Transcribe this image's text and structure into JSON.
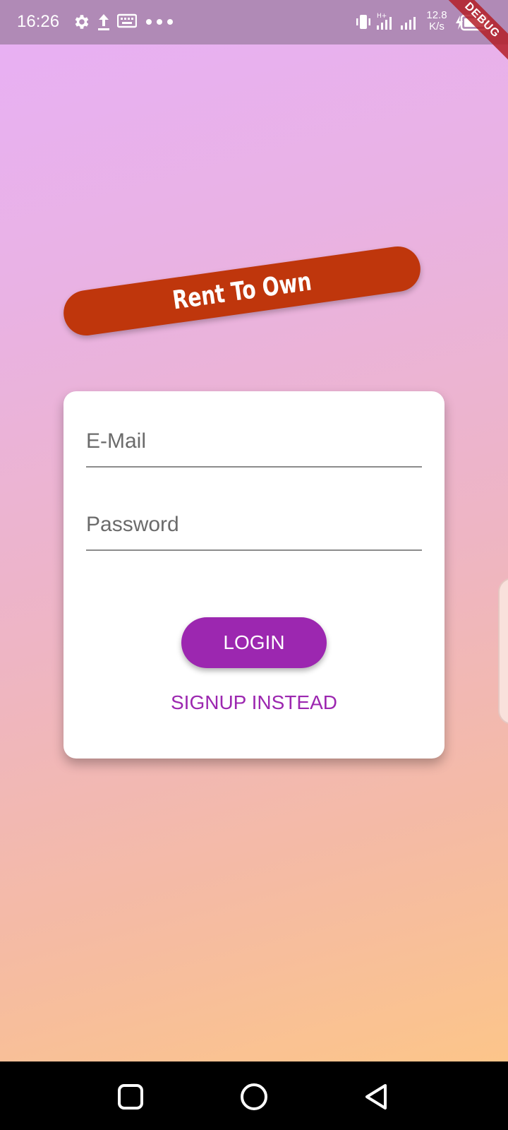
{
  "status_bar": {
    "time": "16:26",
    "left_icons": [
      "settings-icon",
      "upload-icon",
      "keyboard-icon",
      "more-dots-icon"
    ],
    "network_speed": "12.8\nK/s",
    "right_icons": [
      "vibrate-icon",
      "signal-h-plus-icon",
      "signal-icon",
      "battery-charging-icon"
    ]
  },
  "debug_banner": "DEBUG",
  "brand": {
    "title": "Rent To Own",
    "color": "#bf360c"
  },
  "login_form": {
    "email_placeholder": "E-Mail",
    "email_value": "",
    "password_placeholder": "Password",
    "password_value": "",
    "login_label": "LOGIN",
    "signup_label": "SIGNUP INSTEAD",
    "accent_color": "#9c27b0"
  },
  "nav_bar": {
    "buttons": [
      "recents-square-icon",
      "home-circle-icon",
      "back-triangle-icon"
    ]
  }
}
